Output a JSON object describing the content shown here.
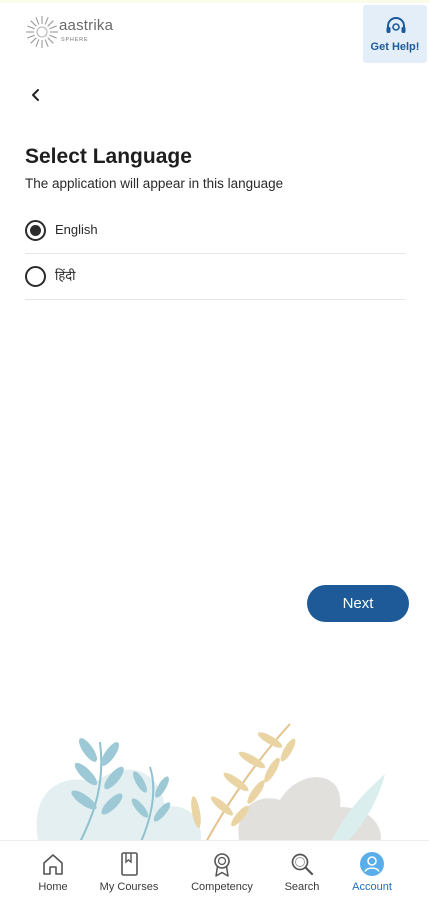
{
  "app": {
    "logo_text": "aastrika",
    "logo_subtext": "SPHERE"
  },
  "header": {
    "help_label": "Get Help!"
  },
  "page": {
    "title": "Select Language",
    "subtitle": "The application will appear in this language"
  },
  "languages": [
    {
      "label": "English",
      "selected": true
    },
    {
      "label": "हिंदी",
      "selected": false
    }
  ],
  "actions": {
    "next_label": "Next"
  },
  "bottom_nav": {
    "active": "Account",
    "items": [
      {
        "label": "Home",
        "icon": "home-icon"
      },
      {
        "label": "My Courses",
        "icon": "book-icon"
      },
      {
        "label": "Competency",
        "icon": "badge-icon"
      },
      {
        "label": "Search",
        "icon": "search-icon"
      },
      {
        "label": "Account",
        "icon": "account-icon"
      }
    ]
  },
  "colors": {
    "primary": "#1d5a97",
    "active_nav": "#2470b8",
    "help_bg": "#e4eef8"
  }
}
